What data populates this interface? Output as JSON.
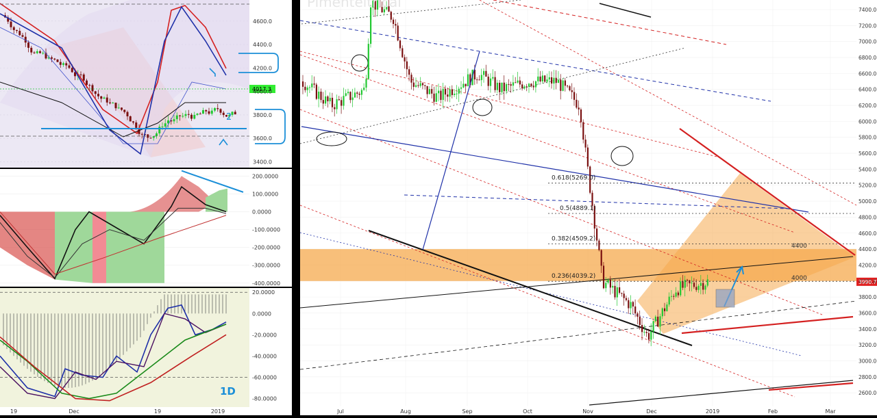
{
  "watermark": "Pimenteltrical",
  "timeframe_label": "1D",
  "colors": {
    "bull": "#22c832",
    "bear": "#7a1010",
    "price_tag": "#e02020",
    "last_tag": "#33ee33",
    "fib_zone": "#f6a94e",
    "red_line": "#d42020",
    "blue_line": "#1e30a8",
    "cyan_annot": "#1b8fd8"
  },
  "chart_data": [
    {
      "type": "candlestick",
      "panel": "left-price",
      "x_ticks": [
        "19",
        "Dec",
        "19",
        "2019"
      ],
      "y_ticks": [
        "4600.0",
        "4400.0",
        "4200.0",
        "4000.0",
        "3800.0",
        "3600.0",
        "3400.0"
      ],
      "ylim": [
        3350,
        4780
      ],
      "last_price": "4017.3",
      "annotations": [
        "2"
      ]
    },
    {
      "type": "area",
      "panel": "left-oscillator",
      "y_ticks": [
        "200.0000",
        "100.0000",
        "0.0000",
        "-100.0000",
        "-200.0000",
        "-300.0000",
        "-400.0000"
      ],
      "ylim": [
        -420,
        240
      ]
    },
    {
      "type": "line",
      "panel": "left-oscillator-2",
      "y_ticks": [
        "20.0000",
        "0.0000",
        "-20.0000",
        "-40.0000",
        "-60.0000",
        "-80.0000"
      ],
      "ylim": [
        -88,
        24
      ],
      "upper_level": 20,
      "lower_level": -60
    },
    {
      "type": "candlestick",
      "panel": "right-price",
      "x_ticks": [
        "Jul",
        "Aug",
        "Sep",
        "Oct",
        "Nov",
        "Dec",
        "2019",
        "Feb",
        "Mar"
      ],
      "y_ticks": [
        "7400.0",
        "7200.0",
        "7000.0",
        "6800.0",
        "6600.0",
        "6400.0",
        "6200.0",
        "6000.0",
        "5800.0",
        "5600.0",
        "5400.0",
        "5200.0",
        "5000.0",
        "4800.0",
        "4600.0",
        "4400.0",
        "4200.0",
        "4000.0",
        "3800.0",
        "3600.0",
        "3400.0",
        "3200.0",
        "3000.0",
        "2800.0",
        "2600.0"
      ],
      "ylim": [
        2430,
        7520
      ],
      "last_price": "3990.7",
      "fib_levels": [
        {
          "label": "0.618(5269.0)",
          "value": 5269.0
        },
        {
          "label": "0.5(4889.1)",
          "value": 4889.1
        },
        {
          "label": "0.382(4509.2)",
          "value": 4509.2
        },
        {
          "label": "0.236(4039.2)",
          "value": 4039.2
        }
      ],
      "horizontal_labels": [
        {
          "label": "4400",
          "value": 4400
        },
        {
          "label": "4000",
          "value": 4000
        }
      ]
    }
  ]
}
